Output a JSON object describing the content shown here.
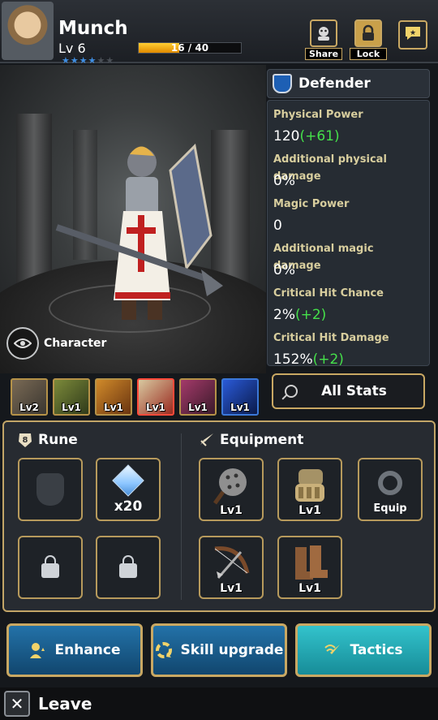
{
  "hero": {
    "name": "Munch",
    "level": "Lv 6",
    "stars_filled": 4,
    "stars_total": 6,
    "xp_text": "16 / 40",
    "xp_fraction": 0.4
  },
  "header_buttons": {
    "share": "Share",
    "lock": "Lock"
  },
  "character_view": {
    "label": "Character"
  },
  "class_panel": {
    "name": "Defender",
    "stats": [
      {
        "label": "Physical Power",
        "value": "120",
        "bonus": "(+61)"
      },
      {
        "label": "Additional physical damage",
        "value": "0%",
        "bonus": ""
      },
      {
        "label": "Magic Power",
        "value": "0",
        "bonus": ""
      },
      {
        "label": "Additional magic damage",
        "value": "0%",
        "bonus": ""
      },
      {
        "label": "Critical Hit Chance",
        "value": "2%",
        "bonus": "(+2)"
      },
      {
        "label": "Critical Hit Damage",
        "value": "152%",
        "bonus": "(+2)"
      }
    ],
    "all_stats_label": "All Stats"
  },
  "skills": [
    {
      "level": "Lv2"
    },
    {
      "level": "Lv1"
    },
    {
      "level": "Lv1"
    },
    {
      "level": "Lv1"
    },
    {
      "level": "Lv1"
    },
    {
      "level": "Lv1"
    }
  ],
  "rune": {
    "title": "Rune",
    "gem_count": "x20"
  },
  "equipment": {
    "title": "Equipment",
    "items": [
      {
        "name": "Mace",
        "level": "Lv1"
      },
      {
        "name": "Gauntlets",
        "level": "Lv1"
      },
      {
        "name": "Ring",
        "level": "Equip"
      },
      {
        "name": "Crossbow",
        "level": "Lv1"
      },
      {
        "name": "Boots",
        "level": "Lv1"
      }
    ]
  },
  "actions": {
    "enhance": "Enhance",
    "skill_upgrade": "Skill upgrade",
    "tactics": "Tactics"
  },
  "footer": {
    "leave": "Leave"
  },
  "colors": {
    "gold_border": "#c9a863",
    "bonus_green": "#45e04a",
    "stat_label": "#d8ce9e",
    "xp_fill": "#f5b000"
  }
}
